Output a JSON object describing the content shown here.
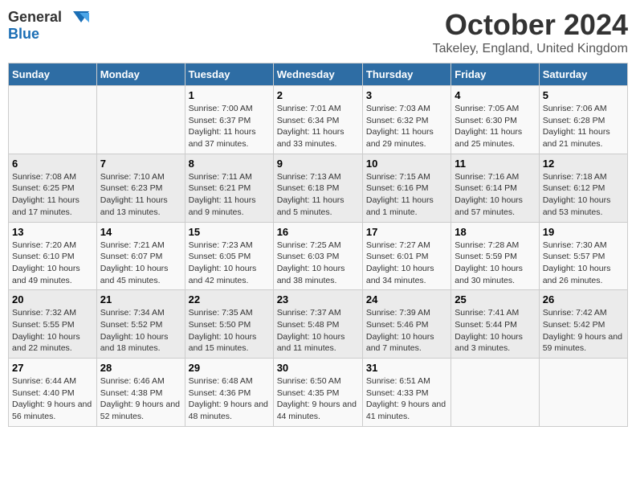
{
  "logo": {
    "general": "General",
    "blue": "Blue"
  },
  "title": {
    "month": "October 2024",
    "location": "Takeley, England, United Kingdom"
  },
  "headers": [
    "Sunday",
    "Monday",
    "Tuesday",
    "Wednesday",
    "Thursday",
    "Friday",
    "Saturday"
  ],
  "weeks": [
    [
      {
        "day": "",
        "info": ""
      },
      {
        "day": "",
        "info": ""
      },
      {
        "day": "1",
        "info": "Sunrise: 7:00 AM\nSunset: 6:37 PM\nDaylight: 11 hours and 37 minutes."
      },
      {
        "day": "2",
        "info": "Sunrise: 7:01 AM\nSunset: 6:34 PM\nDaylight: 11 hours and 33 minutes."
      },
      {
        "day": "3",
        "info": "Sunrise: 7:03 AM\nSunset: 6:32 PM\nDaylight: 11 hours and 29 minutes."
      },
      {
        "day": "4",
        "info": "Sunrise: 7:05 AM\nSunset: 6:30 PM\nDaylight: 11 hours and 25 minutes."
      },
      {
        "day": "5",
        "info": "Sunrise: 7:06 AM\nSunset: 6:28 PM\nDaylight: 11 hours and 21 minutes."
      }
    ],
    [
      {
        "day": "6",
        "info": "Sunrise: 7:08 AM\nSunset: 6:25 PM\nDaylight: 11 hours and 17 minutes."
      },
      {
        "day": "7",
        "info": "Sunrise: 7:10 AM\nSunset: 6:23 PM\nDaylight: 11 hours and 13 minutes."
      },
      {
        "day": "8",
        "info": "Sunrise: 7:11 AM\nSunset: 6:21 PM\nDaylight: 11 hours and 9 minutes."
      },
      {
        "day": "9",
        "info": "Sunrise: 7:13 AM\nSunset: 6:18 PM\nDaylight: 11 hours and 5 minutes."
      },
      {
        "day": "10",
        "info": "Sunrise: 7:15 AM\nSunset: 6:16 PM\nDaylight: 11 hours and 1 minute."
      },
      {
        "day": "11",
        "info": "Sunrise: 7:16 AM\nSunset: 6:14 PM\nDaylight: 10 hours and 57 minutes."
      },
      {
        "day": "12",
        "info": "Sunrise: 7:18 AM\nSunset: 6:12 PM\nDaylight: 10 hours and 53 minutes."
      }
    ],
    [
      {
        "day": "13",
        "info": "Sunrise: 7:20 AM\nSunset: 6:10 PM\nDaylight: 10 hours and 49 minutes."
      },
      {
        "day": "14",
        "info": "Sunrise: 7:21 AM\nSunset: 6:07 PM\nDaylight: 10 hours and 45 minutes."
      },
      {
        "day": "15",
        "info": "Sunrise: 7:23 AM\nSunset: 6:05 PM\nDaylight: 10 hours and 42 minutes."
      },
      {
        "day": "16",
        "info": "Sunrise: 7:25 AM\nSunset: 6:03 PM\nDaylight: 10 hours and 38 minutes."
      },
      {
        "day": "17",
        "info": "Sunrise: 7:27 AM\nSunset: 6:01 PM\nDaylight: 10 hours and 34 minutes."
      },
      {
        "day": "18",
        "info": "Sunrise: 7:28 AM\nSunset: 5:59 PM\nDaylight: 10 hours and 30 minutes."
      },
      {
        "day": "19",
        "info": "Sunrise: 7:30 AM\nSunset: 5:57 PM\nDaylight: 10 hours and 26 minutes."
      }
    ],
    [
      {
        "day": "20",
        "info": "Sunrise: 7:32 AM\nSunset: 5:55 PM\nDaylight: 10 hours and 22 minutes."
      },
      {
        "day": "21",
        "info": "Sunrise: 7:34 AM\nSunset: 5:52 PM\nDaylight: 10 hours and 18 minutes."
      },
      {
        "day": "22",
        "info": "Sunrise: 7:35 AM\nSunset: 5:50 PM\nDaylight: 10 hours and 15 minutes."
      },
      {
        "day": "23",
        "info": "Sunrise: 7:37 AM\nSunset: 5:48 PM\nDaylight: 10 hours and 11 minutes."
      },
      {
        "day": "24",
        "info": "Sunrise: 7:39 AM\nSunset: 5:46 PM\nDaylight: 10 hours and 7 minutes."
      },
      {
        "day": "25",
        "info": "Sunrise: 7:41 AM\nSunset: 5:44 PM\nDaylight: 10 hours and 3 minutes."
      },
      {
        "day": "26",
        "info": "Sunrise: 7:42 AM\nSunset: 5:42 PM\nDaylight: 9 hours and 59 minutes."
      }
    ],
    [
      {
        "day": "27",
        "info": "Sunrise: 6:44 AM\nSunset: 4:40 PM\nDaylight: 9 hours and 56 minutes."
      },
      {
        "day": "28",
        "info": "Sunrise: 6:46 AM\nSunset: 4:38 PM\nDaylight: 9 hours and 52 minutes."
      },
      {
        "day": "29",
        "info": "Sunrise: 6:48 AM\nSunset: 4:36 PM\nDaylight: 9 hours and 48 minutes."
      },
      {
        "day": "30",
        "info": "Sunrise: 6:50 AM\nSunset: 4:35 PM\nDaylight: 9 hours and 44 minutes."
      },
      {
        "day": "31",
        "info": "Sunrise: 6:51 AM\nSunset: 4:33 PM\nDaylight: 9 hours and 41 minutes."
      },
      {
        "day": "",
        "info": ""
      },
      {
        "day": "",
        "info": ""
      }
    ]
  ]
}
